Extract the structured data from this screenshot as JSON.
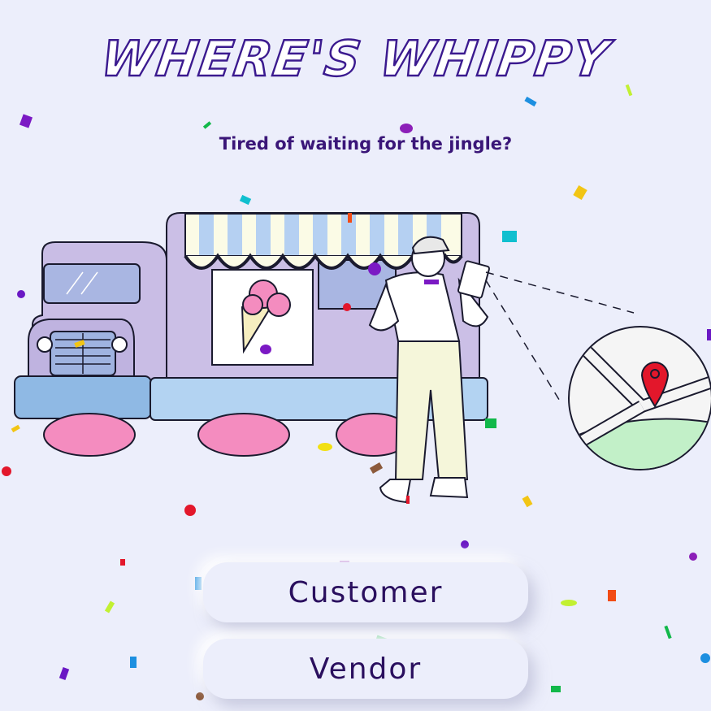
{
  "app": {
    "title": "Where's Whippy",
    "tagline": "Tired of waiting for the jingle?"
  },
  "buttons": {
    "customer_label": "Customer",
    "vendor_label": "Vendor"
  },
  "colors": {
    "background": "#eceefb",
    "accent": "#3b1a8f",
    "truck_body": "#cbbfe6",
    "awning_stripe": "#b5d0f2",
    "map_pin": "#e3172b"
  },
  "icons": [
    "ice-cream-truck-illustration",
    "vendor-person-illustration",
    "map-pin-icon",
    "confetti"
  ]
}
